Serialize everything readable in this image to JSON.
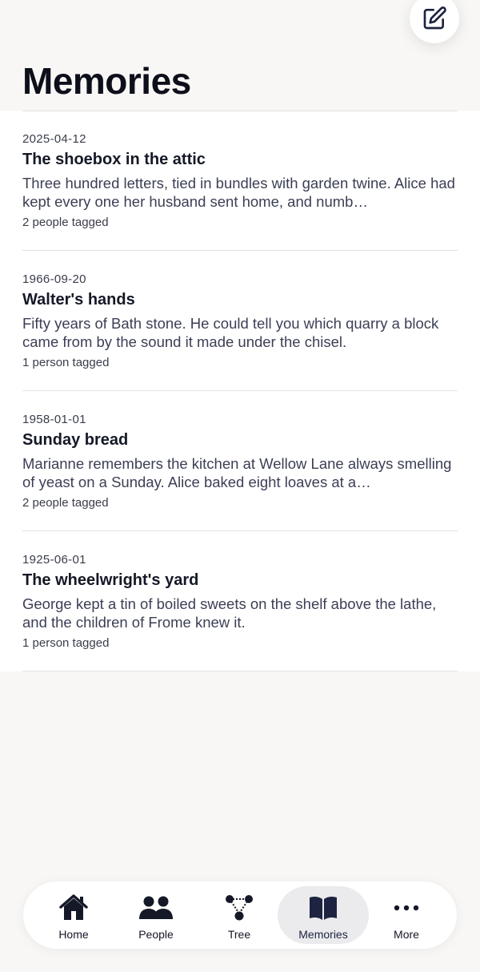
{
  "header": {
    "title": "Memories",
    "compose_icon": "compose-icon"
  },
  "memories": [
    {
      "date": "2025-04-12",
      "title": "The shoebox in the attic",
      "excerpt": "Three hundred letters, tied in bundles with garden twine. Alice had kept every one her husband sent home, and numb…",
      "tags": "2 people tagged"
    },
    {
      "date": "1966-09-20",
      "title": "Walter's hands",
      "excerpt": "Fifty years of Bath stone. He could tell you which quarry a block came from by the sound it made under the chisel.",
      "tags": "1 person tagged"
    },
    {
      "date": "1958-01-01",
      "title": "Sunday bread",
      "excerpt": "Marianne remembers the kitchen at Wellow Lane always smelling of yeast on a Sunday. Alice baked eight loaves at a…",
      "tags": "2 people tagged"
    },
    {
      "date": "1925-06-01",
      "title": "The wheelwright's yard",
      "excerpt": "George kept a tin of boiled sweets on the shelf above the lathe, and the children of Frome knew it.",
      "tags": "1 person tagged"
    }
  ],
  "tabs": [
    {
      "label": "Home",
      "icon": "home-icon",
      "active": false
    },
    {
      "label": "People",
      "icon": "people-icon",
      "active": false
    },
    {
      "label": "Tree",
      "icon": "tree-icon",
      "active": false
    },
    {
      "label": "Memories",
      "icon": "book-icon",
      "active": true
    },
    {
      "label": "More",
      "icon": "more-icon",
      "active": false
    }
  ],
  "colors": {
    "background": "#f8f7f5",
    "card": "#ffffff",
    "text": "#151826",
    "active_tab_bg": "#ebebed",
    "accent": "#1d2340"
  }
}
